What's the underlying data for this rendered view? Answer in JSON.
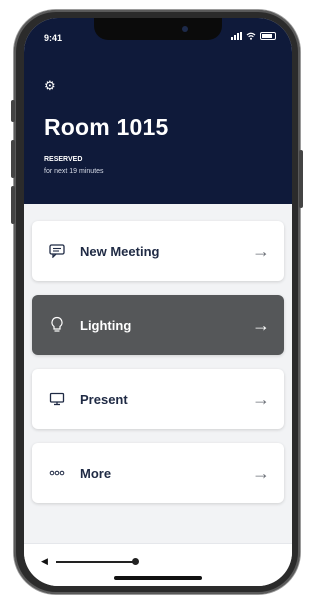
{
  "status_bar": {
    "time": "9:41"
  },
  "header": {
    "room_title": "Room 1015",
    "reservation_status": "RESERVED",
    "reservation_detail": "for next 19 minutes"
  },
  "menu": [
    {
      "label": "New Meeting",
      "icon": "message-icon",
      "active": false
    },
    {
      "label": "Lighting",
      "icon": "lightbulb-icon",
      "active": true
    },
    {
      "label": "Present",
      "icon": "monitor-icon",
      "active": false
    },
    {
      "label": "More",
      "icon": "ellipsis-icon",
      "active": false
    }
  ],
  "arrow_glyph": "→",
  "volume": {
    "level": 0.78
  },
  "colors": {
    "header_bg": "#0f1a3a",
    "active_card": "#555759",
    "card_text": "#1f2a44"
  }
}
